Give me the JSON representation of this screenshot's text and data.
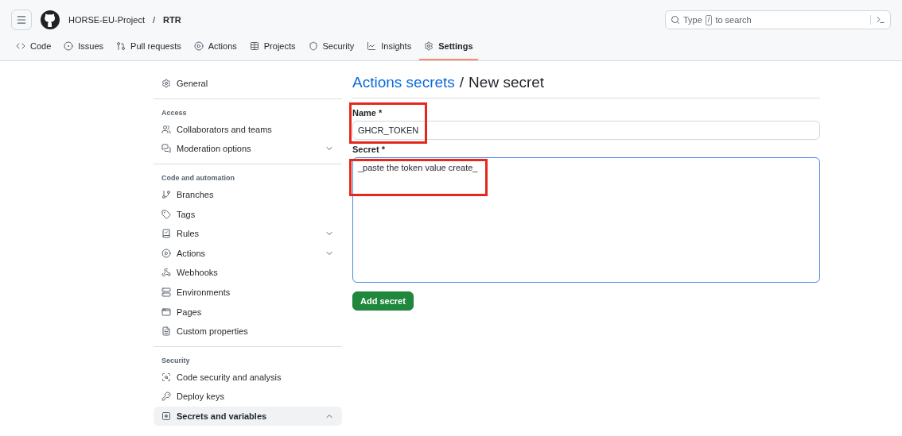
{
  "header": {
    "owner": "HORSE-EU-Project",
    "separator": "/",
    "repo": "RTR",
    "search": {
      "prefix": "Type",
      "key": "/",
      "suffix": "to search"
    }
  },
  "tabs": [
    {
      "label": "Code",
      "selected": false
    },
    {
      "label": "Issues",
      "selected": false
    },
    {
      "label": "Pull requests",
      "selected": false
    },
    {
      "label": "Actions",
      "selected": false
    },
    {
      "label": "Projects",
      "selected": false
    },
    {
      "label": "Security",
      "selected": false
    },
    {
      "label": "Insights",
      "selected": false
    },
    {
      "label": "Settings",
      "selected": true
    }
  ],
  "sidebar": {
    "groups": [
      {
        "items": [
          {
            "label": "General",
            "kind": "link",
            "selected": false
          }
        ]
      },
      {
        "heading": "Access",
        "items": [
          {
            "label": "Collaborators and teams",
            "kind": "link",
            "selected": false
          },
          {
            "label": "Moderation options",
            "kind": "collapsible",
            "expanded": false,
            "selected": false
          }
        ]
      },
      {
        "heading": "Code and automation",
        "items": [
          {
            "label": "Branches",
            "kind": "link",
            "selected": false
          },
          {
            "label": "Tags",
            "kind": "link",
            "selected": false
          },
          {
            "label": "Rules",
            "kind": "collapsible",
            "expanded": false,
            "selected": false
          },
          {
            "label": "Actions",
            "kind": "collapsible",
            "expanded": false,
            "selected": false
          },
          {
            "label": "Webhooks",
            "kind": "link",
            "selected": false
          },
          {
            "label": "Environments",
            "kind": "link",
            "selected": false
          },
          {
            "label": "Pages",
            "kind": "link",
            "selected": false
          },
          {
            "label": "Custom properties",
            "kind": "link",
            "selected": false
          }
        ]
      },
      {
        "heading": "Security",
        "items": [
          {
            "label": "Code security and analysis",
            "kind": "link",
            "selected": false
          },
          {
            "label": "Deploy keys",
            "kind": "link",
            "selected": false
          },
          {
            "label": "Secrets and variables",
            "kind": "collapsible",
            "expanded": true,
            "selected": true
          }
        ]
      }
    ]
  },
  "main": {
    "breadcrumb_link": "Actions secrets",
    "breadcrumb_separator": "/",
    "title": "New secret",
    "name_label": "Name *",
    "name_value": "GHCR_TOKEN",
    "secret_label": "Secret *",
    "secret_value": "_paste the token value create_",
    "submit": "Add secret"
  }
}
